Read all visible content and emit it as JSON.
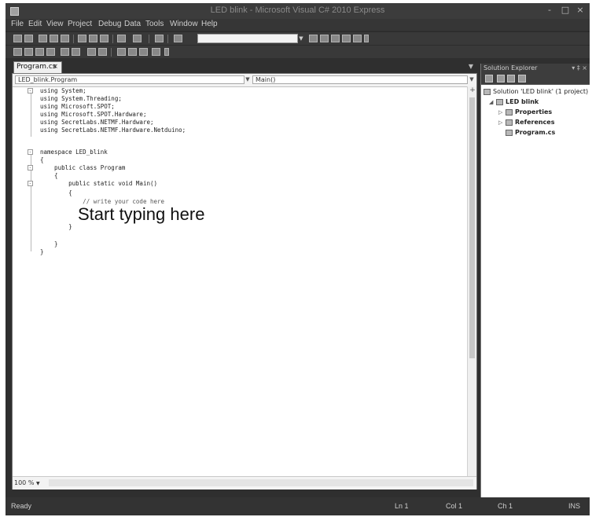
{
  "window": {
    "title": "LED blink - Microsoft Visual C# 2010 Express",
    "controls": [
      "-",
      "□",
      "×"
    ]
  },
  "menu": [
    "File",
    "Edit",
    "View",
    "Project",
    "Debug",
    "Data",
    "Tools",
    "Window",
    "Help"
  ],
  "doc_tab": {
    "label": "Program.cs",
    "close": "×"
  },
  "nav": {
    "type_combo": "LED_blink.Program",
    "member_combo": "Main()"
  },
  "code_lines": [
    "using System;",
    "using System.Threading;",
    "using Microsoft.SPOT;",
    "using Microsoft.SPOT.Hardware;",
    "using SecretLabs.NETMF.Hardware;",
    "using SecretLabs.NETMF.Hardware.Netduino;",
    "",
    "namespace LED_blink",
    "{",
    "    public class Program",
    "    {",
    "        public static void Main()",
    "        {",
    "            // write your code here",
    "        }",
    "",
    "    }",
    "}"
  ],
  "overlay_text": "Start typing here",
  "zoom": "100 %",
  "solution_explorer": {
    "title": "Solution Explorer",
    "header_buttons": "▾ ‡ ×",
    "items": [
      {
        "label": "Solution 'LED blink' (1 project)",
        "bold": false,
        "arrow": ""
      },
      {
        "label": "LED blink",
        "bold": true,
        "arrow": "◢"
      },
      {
        "label": "Properties",
        "bold": true,
        "arrow": "▷"
      },
      {
        "label": "References",
        "bold": true,
        "arrow": "▷"
      },
      {
        "label": "Program.cs",
        "bold": true,
        "arrow": ""
      }
    ]
  },
  "status": {
    "ready": "Ready",
    "line": "Ln 1",
    "col": "Col 1",
    "ch": "Ch 1",
    "ins": "INS"
  }
}
